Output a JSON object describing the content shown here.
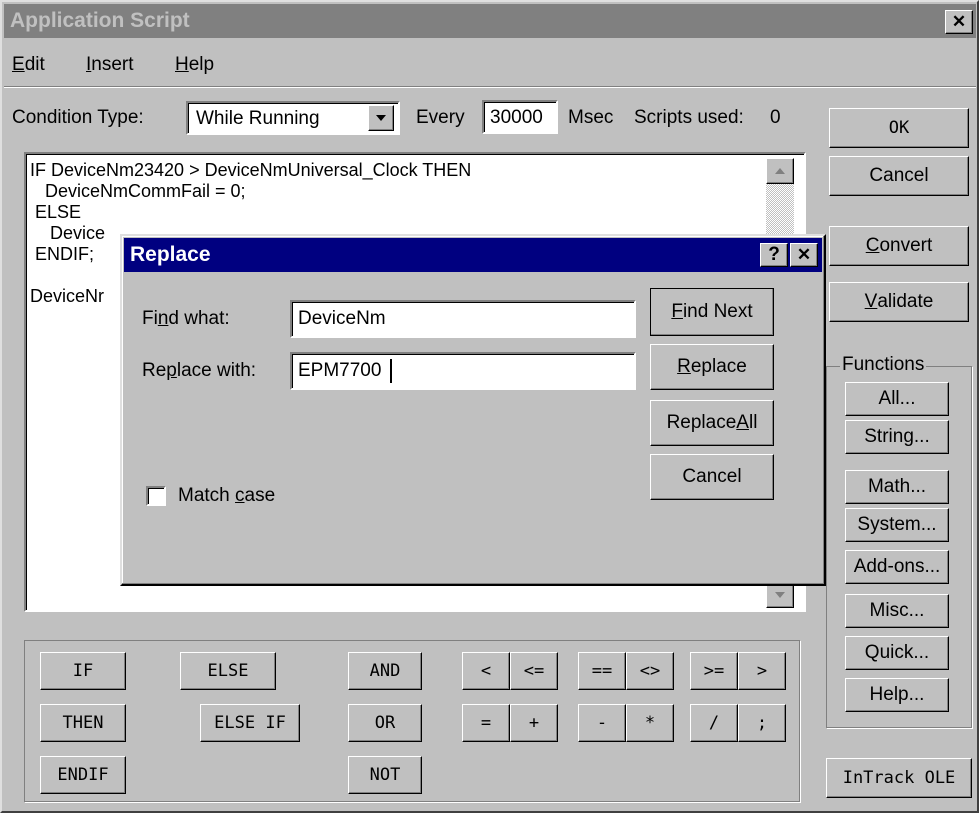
{
  "window": {
    "title": "Application Script",
    "close_glyph": "✕"
  },
  "menu": [
    {
      "pre": "",
      "key": "E",
      "post": "dit"
    },
    {
      "pre": "",
      "key": "I",
      "post": "nsert"
    },
    {
      "pre": "",
      "key": "H",
      "post": "elp"
    }
  ],
  "condition": {
    "label": "Condition Type:",
    "value": "While Running",
    "every_label": "Every",
    "every_value": "30000",
    "msec_label": "Msec",
    "scripts_used_label": "Scripts used:",
    "scripts_used_value": "0"
  },
  "script_lines": [
    "IF DeviceNm23420 > DeviceNmUniversal_Clock THEN",
    "   DeviceNmCommFail = 0;",
    " ELSE",
    "    Device",
    " ENDIF;",
    "",
    "DeviceNr"
  ],
  "side_buttons": {
    "ok": "OK",
    "cancel": "Cancel",
    "convert": {
      "key": "C",
      "post": "onvert"
    },
    "validate": {
      "key": "V",
      "post": "alidate"
    }
  },
  "functions": {
    "label": "Functions",
    "buttons": [
      "All...",
      "String...",
      "Math...",
      "System...",
      "Add-ons...",
      "Misc...",
      "Quick...",
      "Help..."
    ]
  },
  "intrack_ole": "InTrack OLE",
  "keyword_buttons": {
    "if": "IF",
    "then": "THEN",
    "endif": "ENDIF",
    "else": "ELSE",
    "else_if": "ELSE IF",
    "and": "AND",
    "or": "OR",
    "not": "NOT"
  },
  "operator_buttons": {
    "row1": [
      "<",
      "<=",
      "==",
      "<>",
      ">=",
      ">"
    ],
    "row2": [
      "=",
      "+",
      "-",
      "*",
      "/",
      ";"
    ]
  },
  "replace_dialog": {
    "title": "Replace",
    "help_glyph": "?",
    "close_glyph": "✕",
    "find_label": {
      "pre": "Fi",
      "key": "n",
      "post": "d what:"
    },
    "find_value": "DeviceNm",
    "replace_label": {
      "pre": "Re",
      "key": "p",
      "post": "lace with:"
    },
    "replace_value": "EPM7700",
    "match_case": {
      "pre": "Match ",
      "key": "c",
      "post": "ase",
      "checked": false
    },
    "find_next": {
      "pre": "",
      "key": "F",
      "post": "ind Next"
    },
    "replace_btn": {
      "pre": "",
      "key": "R",
      "post": "eplace"
    },
    "replace_all": {
      "pre": "Replace ",
      "key": "A",
      "post": "ll"
    },
    "cancel": "Cancel"
  }
}
